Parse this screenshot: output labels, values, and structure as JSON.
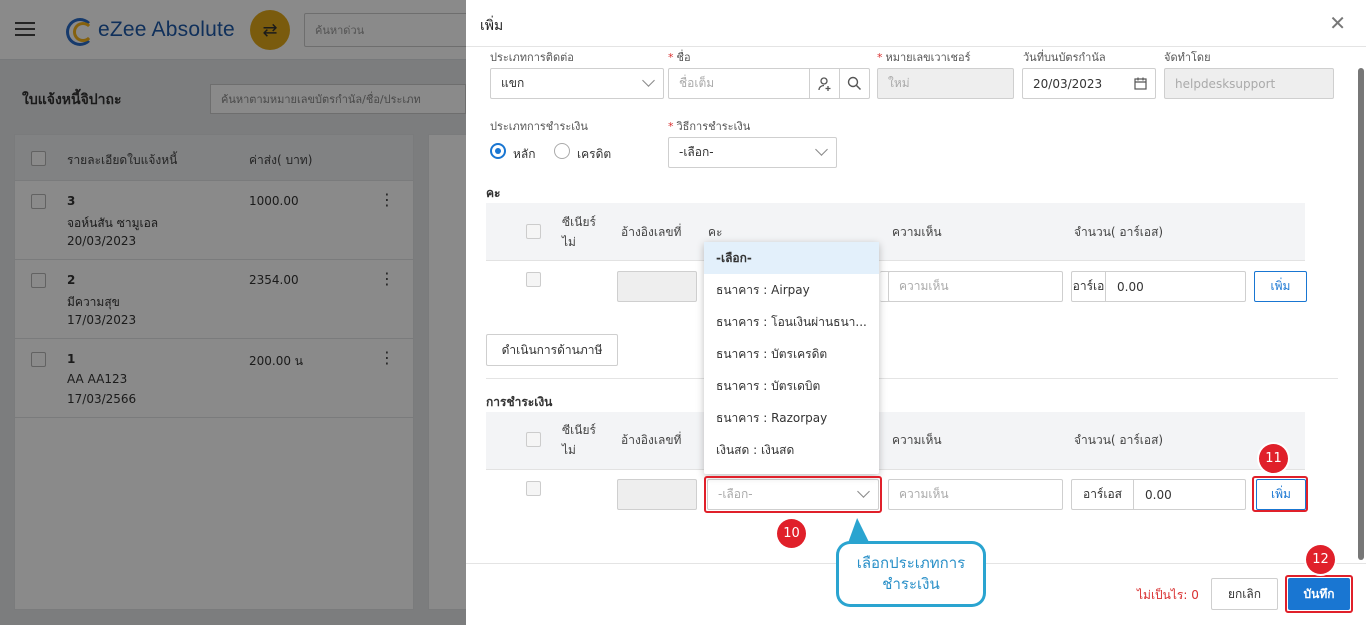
{
  "app": {
    "logo_text": "eZee Absolute",
    "quick_search_placeholder": "ค้นหาด่วน",
    "page_heading": "ใบแจ้งหนี้จิปาถะ",
    "list_search_placeholder": "ค้นหาตามหมายเลขบัตรกำนัล/ชื่อ/ประเภท",
    "list_columns": {
      "details": "รายละเอียดใบแจ้งหนี้",
      "amount": "ค่าส่ง( บาท)"
    },
    "rows": [
      {
        "num": "3",
        "name": "จอห์นสัน ซามูเอล",
        "date": "20/03/2023",
        "amount": "1000.00"
      },
      {
        "num": "2",
        "name": "มีความสุข",
        "date": "17/03/2023",
        "amount": "2354.00"
      },
      {
        "num": "1",
        "name": "AA AA123",
        "date": "17/03/2566",
        "amount": "200.00 น"
      }
    ]
  },
  "modal": {
    "title": "เพิ่ม",
    "contact_type": {
      "label": "ประเภทการติดต่อ",
      "value": "แขก"
    },
    "name": {
      "label": "ชื่อ",
      "placeholder": "ชื่อเต็ม"
    },
    "voucher_no": {
      "label": "หมายเลขเวาเชอร์",
      "placeholder": "ใหม่"
    },
    "voucher_date": {
      "label": "วันที่บนบัตรกำนัล",
      "value": "20/03/2023"
    },
    "prepared_by": {
      "label": "จัดทำโดย",
      "value": "helpdesksupport"
    },
    "payment_type": {
      "label": "ประเภทการชำระเงิน",
      "options": [
        "หลัก",
        "เครดิต"
      ],
      "selected": "หลัก"
    },
    "payment_method": {
      "label": "วิธีการชำระเงิน",
      "value": "-เลือก-"
    },
    "charges_section": {
      "title": "คะ",
      "headers": {
        "cb": "ซีเนียร์",
        "cb2": "ไม่",
        "ref": "อ้างอิงเลขที่",
        "charge": "คะ",
        "comment": "ความเห็น",
        "amount": "จำนวน( อาร์เอส)"
      },
      "comment_placeholder": "ความเห็น",
      "currency": "อาร์เอ",
      "amount": "0.00",
      "add_label": "เพิ่ม",
      "tax_button": "ดำเนินการด้านภาษี"
    },
    "payment_section": {
      "title": "การชำระเงิน",
      "headers": {
        "cb": "ซีเนียร์",
        "cb2": "ไม่",
        "ref": "อ้างอิงเลขที่",
        "comment": "ความเห็น",
        "amount": "จำนวน( อาร์เอส)"
      },
      "select_placeholder": "-เลือก-",
      "comment_placeholder": "ความเห็น",
      "currency": "อาร์เอส",
      "amount": "0.00",
      "add_label": "เพิ่ม"
    },
    "dropdown_options": [
      "-เลือก-",
      "ธนาคาร : Airpay",
      "ธนาคาร : โอนเงินผ่านธนา...",
      "ธนาคาร : บัตรเครดิต",
      "ธนาคาร : บัตรเดบิต",
      "ธนาคาร : Razorpay",
      "เงินสด : เงินสด"
    ],
    "footer": {
      "unpaid": "ไม่เป็นไร: 0",
      "cancel": "ยกเลิก",
      "save": "บันทึก"
    }
  },
  "annotations": {
    "steps": [
      "10",
      "11",
      "12"
    ],
    "callout_line1": "เลือกประเภทการ",
    "callout_line2": "ชำระเงิน"
  },
  "colors": {
    "primary": "#1976d2",
    "highlight": "#e0202a",
    "callout": "#2aa4d0",
    "accent": "#e2a918"
  }
}
